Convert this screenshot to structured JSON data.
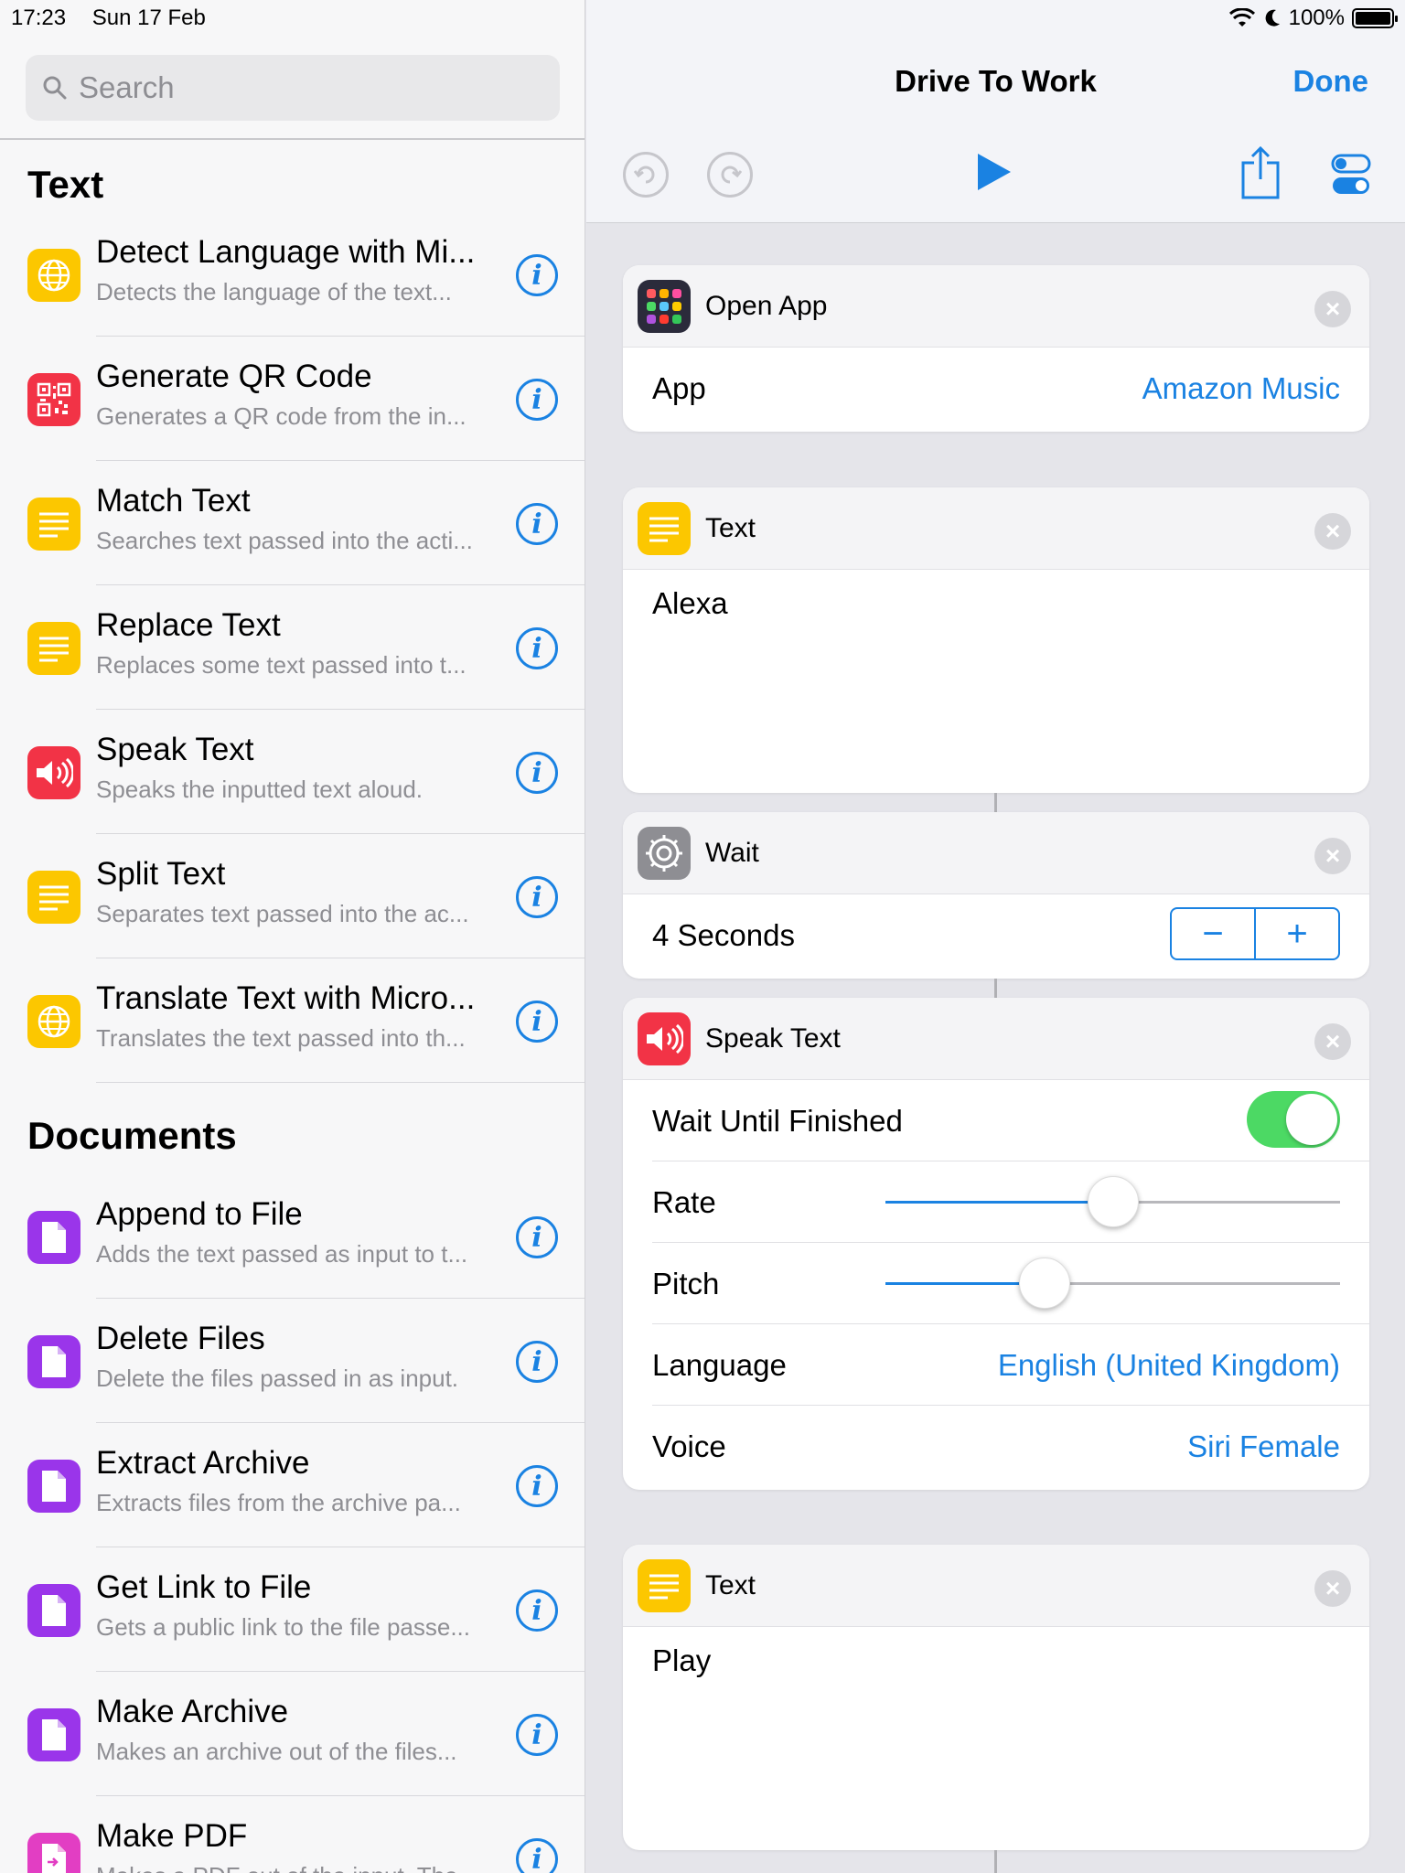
{
  "status": {
    "time": "17:23",
    "date": "Sun 17 Feb",
    "battery": "100%"
  },
  "search": {
    "placeholder": "Search"
  },
  "sections": [
    {
      "title": "Text",
      "items": [
        {
          "title": "Detect Language with Mi...",
          "subtitle": "Detects the language of the text...",
          "icon": "globe-icon",
          "color": "yellow"
        },
        {
          "title": "Generate QR Code",
          "subtitle": "Generates a QR code from the in...",
          "icon": "qr-code-icon",
          "color": "red"
        },
        {
          "title": "Match Text",
          "subtitle": "Searches text passed into the acti...",
          "icon": "text-lines-icon",
          "color": "yellow"
        },
        {
          "title": "Replace Text",
          "subtitle": "Replaces some text passed into t...",
          "icon": "text-lines-icon",
          "color": "yellow"
        },
        {
          "title": "Speak Text",
          "subtitle": "Speaks the inputted text aloud.",
          "icon": "speaker-icon",
          "color": "red"
        },
        {
          "title": "Split Text",
          "subtitle": "Separates text passed into the ac...",
          "icon": "text-lines-icon",
          "color": "yellow"
        },
        {
          "title": "Translate Text with Micro...",
          "subtitle": "Translates the text passed into th...",
          "icon": "globe-icon",
          "color": "yellow"
        }
      ]
    },
    {
      "title": "Documents",
      "items": [
        {
          "title": "Append to File",
          "subtitle": "Adds the text passed as input to t...",
          "icon": "document-icon",
          "color": "purple"
        },
        {
          "title": "Delete Files",
          "subtitle": "Delete the files passed in as input.",
          "icon": "document-icon",
          "color": "purple"
        },
        {
          "title": "Extract Archive",
          "subtitle": "Extracts files from the archive pa...",
          "icon": "document-icon",
          "color": "purple"
        },
        {
          "title": "Get Link to File",
          "subtitle": "Gets a public link to the file passe...",
          "icon": "document-icon",
          "color": "purple"
        },
        {
          "title": "Make Archive",
          "subtitle": "Makes an archive out of the files...",
          "icon": "document-icon",
          "color": "purple"
        },
        {
          "title": "Make PDF",
          "subtitle": "Makes a PDF out of the input. The",
          "icon": "pdf-document-icon",
          "color": "pink"
        }
      ]
    }
  ],
  "nav": {
    "title": "Drive To Work",
    "done_label": "Done"
  },
  "cards": {
    "open_app": {
      "title": "Open App",
      "app_label": "App",
      "app_value": "Amazon Music"
    },
    "text1": {
      "title": "Text",
      "body": "Alexa"
    },
    "wait": {
      "title": "Wait",
      "value": "4 Seconds",
      "minus": "−",
      "plus": "+"
    },
    "speak": {
      "title": "Speak Text",
      "wait_label": "Wait Until Finished",
      "wait_on": true,
      "rate_label": "Rate",
      "rate_value": 0.5,
      "pitch_label": "Pitch",
      "pitch_value": 0.35,
      "language_label": "Language",
      "language_value": "English (United Kingdom)",
      "voice_label": "Voice",
      "voice_value": "Siri Female"
    },
    "text2": {
      "title": "Text",
      "body": "Play"
    }
  },
  "colors": {
    "accent": "#1a82e2",
    "toggle_on": "#4cd964",
    "yellow": "#fcc700",
    "red": "#f23346",
    "purple": "#9a35ea"
  }
}
